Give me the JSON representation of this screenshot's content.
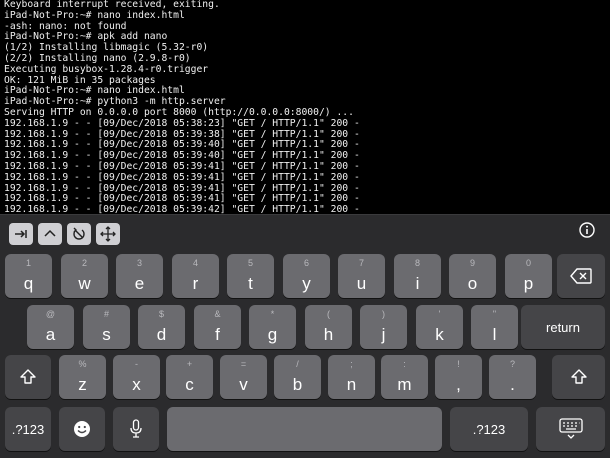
{
  "terminal": {
    "lines": [
      "Keyboard interrupt received, exiting.",
      "iPad-Not-Pro:~# nano index.html",
      "-ash: nano: not found",
      "iPad-Not-Pro:~# apk add nano",
      "(1/2) Installing libmagic (5.32-r0)",
      "(2/2) Installing nano (2.9.8-r0)",
      "Executing busybox-1.28.4-r0.trigger",
      "OK: 121 MiB in 35 packages",
      "iPad-Not-Pro:~# nano index.html",
      "iPad-Not-Pro:~# python3 -m http.server",
      "Serving HTTP on 0.0.0.0 port 8000 (http://0.0.0.0:8000/) ...",
      "192.168.1.9 - - [09/Dec/2018 05:38:23] \"GET / HTTP/1.1\" 200 -",
      "192.168.1.9 - - [09/Dec/2018 05:39:38] \"GET / HTTP/1.1\" 200 -",
      "192.168.1.9 - - [09/Dec/2018 05:39:40] \"GET / HTTP/1.1\" 200 -",
      "192.168.1.9 - - [09/Dec/2018 05:39:40] \"GET / HTTP/1.1\" 200 -",
      "192.168.1.9 - - [09/Dec/2018 05:39:41] \"GET / HTTP/1.1\" 200 -",
      "192.168.1.9 - - [09/Dec/2018 05:39:41] \"GET / HTTP/1.1\" 200 -",
      "192.168.1.9 - - [09/Dec/2018 05:39:41] \"GET / HTTP/1.1\" 200 -",
      "192.168.1.9 - - [09/Dec/2018 05:39:41] \"GET / HTTP/1.1\" 200 -",
      "192.168.1.9 - - [09/Dec/2018 05:39:42] \"GET / HTTP/1.1\" 200 -",
      "192.168.1.9 - - [09/Dec/2018 05:39:42] \"GET / HTTP/1.1\" 200 -"
    ]
  },
  "shortcut_bar": {
    "buttons": [
      "tab-icon",
      "control-icon",
      "escape-icon",
      "arrow-keys-icon"
    ],
    "info": "info-icon"
  },
  "keyboard": {
    "row1": [
      {
        "hint": "1",
        "key": "q"
      },
      {
        "hint": "2",
        "key": "w"
      },
      {
        "hint": "3",
        "key": "e"
      },
      {
        "hint": "4",
        "key": "r"
      },
      {
        "hint": "5",
        "key": "t"
      },
      {
        "hint": "6",
        "key": "y"
      },
      {
        "hint": "7",
        "key": "u"
      },
      {
        "hint": "8",
        "key": "i"
      },
      {
        "hint": "9",
        "key": "o"
      },
      {
        "hint": "0",
        "key": "p"
      }
    ],
    "row2": [
      {
        "hint": "@",
        "key": "a"
      },
      {
        "hint": "#",
        "key": "s"
      },
      {
        "hint": "$",
        "key": "d"
      },
      {
        "hint": "&",
        "key": "f"
      },
      {
        "hint": "*",
        "key": "g"
      },
      {
        "hint": "(",
        "key": "h"
      },
      {
        "hint": ")",
        "key": "j"
      },
      {
        "hint": "'",
        "key": "k"
      },
      {
        "hint": "\"",
        "key": "l"
      }
    ],
    "row3": [
      {
        "hint": "%",
        "key": "z"
      },
      {
        "hint": "-",
        "key": "x"
      },
      {
        "hint": "+",
        "key": "c"
      },
      {
        "hint": "=",
        "key": "v"
      },
      {
        "hint": "/",
        "key": "b"
      },
      {
        "hint": ";",
        "key": "n"
      },
      {
        "hint": ":",
        "key": "m"
      },
      {
        "hint": "!",
        "key": ","
      },
      {
        "hint": "?",
        "key": "."
      }
    ],
    "return_label": "return",
    "numbers_label": ".?123",
    "numbers_label_right": ".?123",
    "space_label": "",
    "icons": {
      "delete": "delete-icon",
      "shift": "shift-icon",
      "emoji": "emoji-icon",
      "mic": "microphone-icon",
      "hide": "keyboard-hide-icon"
    },
    "colors": {
      "letter_key": "#6b6b6f",
      "special_key": "#454548",
      "background": "#2b2b2d"
    }
  }
}
